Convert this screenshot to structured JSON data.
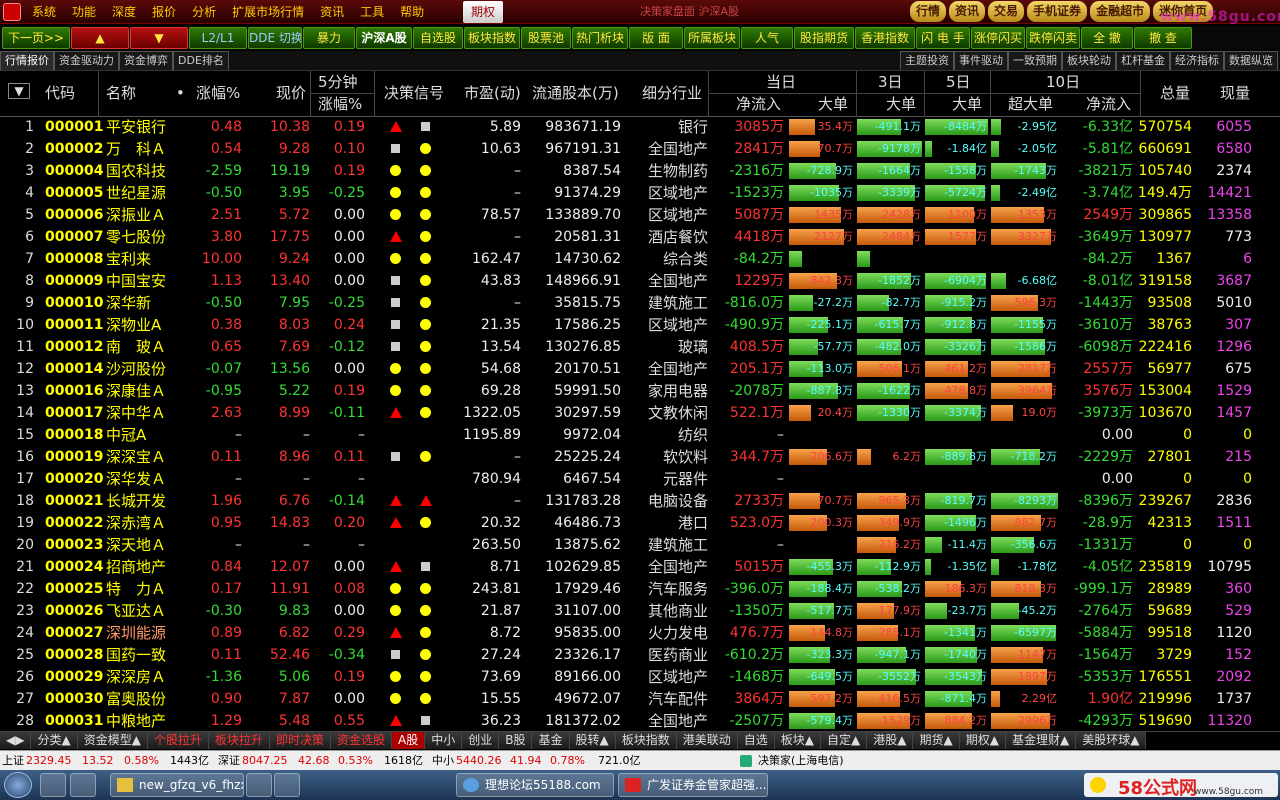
{
  "menu": [
    "系统",
    "功能",
    "深度",
    "报价",
    "分析",
    "扩展市场行情",
    "资讯",
    "工具",
    "帮助"
  ],
  "menu_active": "期权",
  "menu_marquee": "决策家盘面 沪深A股",
  "topright": [
    "行情",
    "资讯",
    "交易",
    "手机证券",
    "金融超市",
    "迷你首页"
  ],
  "watermark": "www.58gu.com",
  "toolbar": [
    "下一页>>",
    "▲",
    "▼",
    "L2/L1",
    "DDE 切换",
    "暴力",
    "沪深A股",
    "自选股",
    "板块指数",
    "股票池",
    "热门析块",
    "版 面",
    "所属板块",
    "人气",
    "股指期货",
    "香港指数",
    "闪 电 手",
    "涨停闪买",
    "跌停闪卖",
    "全 撤",
    "撤 查"
  ],
  "subtabs_left": [
    "行情报价",
    "资金驱动力",
    "资金博弈",
    "DDE排名"
  ],
  "subtabs_right": [
    "主题投资",
    "事件驱动",
    "一致预期",
    "板块轮动",
    "杠杆基金",
    "经济指标",
    "数据纵览"
  ],
  "headers": {
    "sort": "▼",
    "code": "代码",
    "name": "名称",
    "dot": "•",
    "change": "涨幅%",
    "price": "现价",
    "m5a": "5分钟",
    "m5b": "涨幅%",
    "signal": "决策信号",
    "pe": "市盈(动)",
    "float": "流通股本(万)",
    "industry": "细分行业",
    "today": "当日",
    "net": "净流入",
    "big": "大单",
    "d3": "3日",
    "d5": "5日",
    "d10": "10日",
    "superbig": "超大单",
    "net10": "净流入",
    "vol": "总量",
    "cur": "现量"
  },
  "rows": [
    {
      "i": "1",
      "code": "000001",
      "name": "平安银行",
      "chg": "0.48",
      "price": "10.38",
      "m5": "0.19",
      "sig": [
        "t",
        "s"
      ],
      "pe": "5.89",
      "float": "983671.19",
      "ind": "银行",
      "net": "3085万",
      "b1": [
        35.4,
        "35.4万"
      ],
      "b3": [
        -491.1,
        "-491.1万"
      ],
      "b5": [
        -8484,
        "-8484万"
      ],
      "b10": [
        -2.95,
        "-2.95亿"
      ],
      "net10": "-6.33亿",
      "vol": "570754",
      "cur": "6055"
    },
    {
      "i": "2",
      "code": "000002",
      "name": "万　科Ａ",
      "chg": "0.54",
      "price": "9.28",
      "m5": "0.10",
      "sig": [
        "s",
        "d"
      ],
      "pe": "10.63",
      "float": "967191.31",
      "ind": "全国地产",
      "net": "2841万",
      "b1": [
        70.7,
        "70.7万"
      ],
      "b3": [
        -9178,
        "-9178万"
      ],
      "b5": [
        -1.84,
        "-1.84亿"
      ],
      "b10": [
        -2.05,
        "-2.05亿"
      ],
      "net10": "-5.81亿",
      "vol": "660691",
      "cur": "6580"
    },
    {
      "i": "3",
      "code": "000004",
      "name": "国农科技",
      "chg": "-2.59",
      "price": "19.19",
      "m5": "0.19",
      "sig": [
        "d",
        "d"
      ],
      "pe": "–",
      "float": "8387.54",
      "ind": "生物制药",
      "net": "-2316万",
      "b1": [
        -728.9,
        "-728.9万"
      ],
      "b3": [
        -1664,
        "-1664万"
      ],
      "b5": [
        -1558,
        "-1558万"
      ],
      "b10": [
        -1743,
        "-1743万"
      ],
      "net10": "-3821万",
      "vol": "105740",
      "cur": "2374"
    },
    {
      "i": "4",
      "code": "000005",
      "name": "世纪星源",
      "chg": "-0.50",
      "price": "3.95",
      "m5": "-0.25",
      "sig": [
        "d",
        "d"
      ],
      "pe": "–",
      "float": "91374.29",
      "ind": "区域地产",
      "net": "-1523万",
      "b1": [
        -1035,
        "-1035万"
      ],
      "b3": [
        -3339,
        "-3339万"
      ],
      "b5": [
        -5724,
        "-5724万"
      ],
      "b10": [
        -2.49,
        "-2.49亿"
      ],
      "net10": "-3.74亿",
      "vol": "149.4万",
      "cur": "14421"
    },
    {
      "i": "5",
      "code": "000006",
      "name": "深振业Ａ",
      "chg": "2.51",
      "price": "5.72",
      "m5": "0.00",
      "sig": [
        "d",
        "d"
      ],
      "pe": "78.57",
      "float": "133889.70",
      "ind": "区域地产",
      "net": "5087万",
      "b1": [
        1435,
        "1435万"
      ],
      "b3": [
        2428,
        "2428万"
      ],
      "b5": [
        1100,
        "1100万"
      ],
      "b10": [
        1353,
        "1353万"
      ],
      "net10": "2549万",
      "vol": "309865",
      "cur": "13358"
    },
    {
      "i": "6",
      "code": "000007",
      "name": "零七股份",
      "chg": "3.80",
      "price": "17.75",
      "m5": "0.00",
      "sig": [
        "t",
        "d"
      ],
      "pe": "–",
      "float": "20581.31",
      "ind": "酒店餐饮",
      "net": "4418万",
      "b1": [
        2127,
        "2127万"
      ],
      "b3": [
        2484,
        "2484万"
      ],
      "b5": [
        1577,
        "1577万"
      ],
      "b10": [
        3327,
        "3327万"
      ],
      "net10": "-3649万",
      "vol": "130977",
      "cur": "773"
    },
    {
      "i": "7",
      "code": "000008",
      "name": "宝利来",
      "chg": "10.00",
      "price": "9.24",
      "m5": "0.00",
      "sig": [
        "d",
        "d"
      ],
      "pe": "162.47",
      "float": "14730.62",
      "ind": "综合类",
      "net": "-84.2万",
      "b1": [
        -5,
        ""
      ],
      "b3": [
        -5,
        ""
      ],
      "b5": [
        0,
        ""
      ],
      "b10": [
        0,
        ""
      ],
      "net10": "-84.2万",
      "vol": "1367",
      "cur": "6"
    },
    {
      "i": "8",
      "code": "000009",
      "name": "中国宝安",
      "chg": "1.13",
      "price": "13.40",
      "m5": "0.00",
      "sig": [
        "s",
        "d"
      ],
      "pe": "43.83",
      "float": "148966.91",
      "ind": "全国地产",
      "net": "1229万",
      "b1": [
        842.3,
        "842.3万"
      ],
      "b3": [
        -1852,
        "-1852万"
      ],
      "b5": [
        -6904,
        "-6904万"
      ],
      "b10": [
        -6.68,
        "-6.68亿"
      ],
      "net10": "-8.01亿",
      "vol": "319158",
      "cur": "3687"
    },
    {
      "i": "9",
      "code": "000010",
      "name": "深华新",
      "chg": "-0.50",
      "price": "7.95",
      "m5": "-0.25",
      "sig": [
        "s",
        "d"
      ],
      "pe": "–",
      "float": "35815.75",
      "ind": "建筑施工",
      "net": "-816.0万",
      "b1": [
        -27.2,
        "-27.2万"
      ],
      "b3": [
        -82.7,
        "-82.7万"
      ],
      "b5": [
        -915.2,
        "-915.2万"
      ],
      "b10": [
        596.3,
        "596.3万"
      ],
      "net10": "-1443万",
      "vol": "93508",
      "cur": "5010"
    },
    {
      "i": "10",
      "code": "000011",
      "name": "深物业A",
      "chg": "0.38",
      "price": "8.03",
      "m5": "0.24",
      "sig": [
        "s",
        "d"
      ],
      "pe": "21.35",
      "float": "17586.25",
      "ind": "区域地产",
      "net": "-490.9万",
      "b1": [
        -225.1,
        "-225.1万"
      ],
      "b3": [
        -615.7,
        "-615.7万"
      ],
      "b5": [
        -912.8,
        "-912.8万"
      ],
      "b10": [
        -1155,
        "-1155万"
      ],
      "net10": "-3610万",
      "vol": "38763",
      "cur": "307"
    },
    {
      "i": "11",
      "code": "000012",
      "name": "南　玻Ａ",
      "chg": "0.65",
      "price": "7.69",
      "m5": "-0.12",
      "sig": [
        "s",
        "d"
      ],
      "pe": "13.54",
      "float": "130276.85",
      "ind": "玻璃",
      "net": "408.5万",
      "b1": [
        -57.7,
        "-57.7万"
      ],
      "b3": [
        -482,
        "-482.0万"
      ],
      "b5": [
        -3326,
        "-3326万"
      ],
      "b10": [
        -1586,
        "-1586万"
      ],
      "net10": "-6098万",
      "vol": "222416",
      "cur": "1296"
    },
    {
      "i": "12",
      "code": "000014",
      "name": "沙河股份",
      "chg": "-0.07",
      "price": "13.56",
      "m5": "0.00",
      "sig": [
        "d",
        "d"
      ],
      "pe": "54.68",
      "float": "20170.51",
      "ind": "全国地产",
      "net": "205.1万",
      "b1": [
        -113,
        "-113.0万"
      ],
      "b3": [
        506.1,
        "506.1万"
      ],
      "b5": [
        461.2,
        "461.2万"
      ],
      "b10": [
        2817,
        "2817万"
      ],
      "net10": "2557万",
      "vol": "56977",
      "cur": "675"
    },
    {
      "i": "13",
      "code": "000016",
      "name": "深康佳Ａ",
      "chg": "-0.95",
      "price": "5.22",
      "m5": "0.19",
      "sig": [
        "d",
        "d"
      ],
      "pe": "69.28",
      "float": "59991.50",
      "ind": "家用电器",
      "net": "-2078万",
      "b1": [
        -887.8,
        "-887.8万"
      ],
      "b3": [
        -1622,
        "-1622万"
      ],
      "b5": [
        478.8,
        "478.8万"
      ],
      "b10": [
        3964,
        "3964万"
      ],
      "net10": "3576万",
      "vol": "153004",
      "cur": "1529"
    },
    {
      "i": "14",
      "code": "000017",
      "name": "深中华Ａ",
      "chg": "2.63",
      "price": "8.99",
      "m5": "-0.11",
      "sig": [
        "t",
        "d"
      ],
      "pe": "1322.05",
      "float": "30297.59",
      "ind": "文教休闲",
      "net": "522.1万",
      "b1": [
        20.4,
        "20.4万"
      ],
      "b3": [
        -1330,
        "-1330万"
      ],
      "b5": [
        -3374,
        "-3374万"
      ],
      "b10": [
        19,
        "19.0万"
      ],
      "net10": "-3973万",
      "vol": "103670",
      "cur": "1457"
    },
    {
      "i": "15",
      "code": "000018",
      "name": "中冠A",
      "chg": "–",
      "price": "–",
      "m5": "–",
      "sig": [],
      "pe": "1195.89",
      "float": "9972.04",
      "ind": "纺织",
      "net": "–",
      "b1": [
        0,
        ""
      ],
      "b3": [
        0,
        ""
      ],
      "b5": [
        0,
        ""
      ],
      "b10": [
        0,
        ""
      ],
      "net10": "0.00",
      "vol": "0",
      "cur": "0"
    },
    {
      "i": "16",
      "code": "000019",
      "name": "深深宝Ａ",
      "chg": "0.11",
      "price": "8.96",
      "m5": "0.11",
      "sig": [
        "s",
        "d"
      ],
      "pe": "–",
      "float": "25225.24",
      "ind": "软饮料",
      "net": "344.7万",
      "b1": [
        206.6,
        "206.6万"
      ],
      "b3": [
        6.2,
        "6.2万"
      ],
      "b5": [
        -889.8,
        "-889.8万"
      ],
      "b10": [
        -718.2,
        "-718.2万"
      ],
      "net10": "-2229万",
      "vol": "27801",
      "cur": "215"
    },
    {
      "i": "17",
      "code": "000020",
      "name": "深华发Ａ",
      "chg": "–",
      "price": "–",
      "m5": "–",
      "sig": [],
      "pe": "780.94",
      "float": "6467.54",
      "ind": "元器件",
      "net": "–",
      "b1": [
        0,
        ""
      ],
      "b3": [
        0,
        ""
      ],
      "b5": [
        0,
        ""
      ],
      "b10": [
        0,
        ""
      ],
      "net10": "0.00",
      "vol": "0",
      "cur": "0"
    },
    {
      "i": "18",
      "code": "000021",
      "name": "长城开发",
      "chg": "1.96",
      "price": "6.76",
      "m5": "-0.14",
      "sig": [
        "t",
        "t"
      ],
      "pe": "–",
      "float": "131783.28",
      "ind": "电脑设备",
      "net": "2733万",
      "b1": [
        70.7,
        "70.7万"
      ],
      "b3": [
        965.3,
        "965.3万"
      ],
      "b5": [
        -819.7,
        "-819.7万"
      ],
      "b10": [
        -8293,
        "-8293万"
      ],
      "net10": "-8396万",
      "vol": "239267",
      "cur": "2836"
    },
    {
      "i": "19",
      "code": "000022",
      "name": "深赤湾Ａ",
      "chg": "0.95",
      "price": "14.83",
      "m5": "0.20",
      "sig": [
        "t",
        "d"
      ],
      "pe": "20.32",
      "float": "46486.73",
      "ind": "港口",
      "net": "523.0万",
      "b1": [
        200.3,
        "200.3万"
      ],
      "b3": [
        349.9,
        "349.9万"
      ],
      "b5": [
        -1496,
        "-1496万"
      ],
      "b10": [
        882.7,
        "882.7万"
      ],
      "net10": "-28.9万",
      "vol": "42313",
      "cur": "1511"
    },
    {
      "i": "20",
      "code": "000023",
      "name": "深天地Ａ",
      "chg": "–",
      "price": "–",
      "m5": "–",
      "sig": [],
      "pe": "263.50",
      "float": "13875.62",
      "ind": "建筑施工",
      "net": "–",
      "b1": [
        0,
        ""
      ],
      "b3": [
        216.2,
        "216.2万"
      ],
      "b5": [
        -11.4,
        "-11.4万"
      ],
      "b10": [
        -356.6,
        "-356.6万"
      ],
      "net10": "-1331万",
      "vol": "0",
      "cur": "0"
    },
    {
      "i": "21",
      "code": "000024",
      "name": "招商地产",
      "chg": "0.84",
      "price": "12.07",
      "m5": "0.00",
      "sig": [
        "t",
        "s"
      ],
      "pe": "8.71",
      "float": "102629.85",
      "ind": "全国地产",
      "net": "5015万",
      "b1": [
        -455.3,
        "-455.3万"
      ],
      "b3": [
        -112.9,
        "-112.9万"
      ],
      "b5": [
        -1.35,
        "-1.35亿"
      ],
      "b10": [
        -1.78,
        "-1.78亿"
      ],
      "net10": "-4.05亿",
      "vol": "235819",
      "cur": "10795"
    },
    {
      "i": "22",
      "code": "000025",
      "name": "特　力Ａ",
      "chg": "0.17",
      "price": "11.91",
      "m5": "0.08",
      "sig": [
        "d",
        "d"
      ],
      "pe": "243.81",
      "float": "17929.46",
      "ind": "汽车服务",
      "net": "-396.0万",
      "b1": [
        -188.4,
        "-188.4万"
      ],
      "b3": [
        -538.2,
        "-538.2万"
      ],
      "b5": [
        186.3,
        "186.3万"
      ],
      "b10": [
        818.3,
        "818.3万"
      ],
      "net10": "-999.1万",
      "vol": "28989",
      "cur": "360"
    },
    {
      "i": "23",
      "code": "000026",
      "name": "飞亚达Ａ",
      "chg": "-0.30",
      "price": "9.83",
      "m5": "0.00",
      "sig": [
        "d",
        "d"
      ],
      "pe": "21.87",
      "float": "31107.00",
      "ind": "其他商业",
      "net": "-1350万",
      "b1": [
        -517.7,
        "-517.7万"
      ],
      "b3": [
        177.9,
        "177.9万"
      ],
      "b5": [
        -23.7,
        "-23.7万"
      ],
      "b10": [
        -45.2,
        "-45.2万"
      ],
      "net10": "-2764万",
      "vol": "59689",
      "cur": "529"
    },
    {
      "i": "24",
      "code": "000027",
      "name": "深圳能源",
      "chg": "0.89",
      "price": "6.82",
      "m5": "0.29",
      "sig": [
        "t",
        "d"
      ],
      "pe": "8.72",
      "float": "95835.00",
      "ind": "火力发电",
      "net": "476.7万",
      "b1": [
        144.8,
        "144.8万"
      ],
      "b3": [
        285.1,
        "285.1万"
      ],
      "b5": [
        -1341,
        "-1341万"
      ],
      "b10": [
        -6597,
        "-6597万"
      ],
      "net10": "-5884万",
      "vol": "99518",
      "cur": "1120"
    },
    {
      "i": "25",
      "code": "000028",
      "name": "国药一致",
      "chg": "0.11",
      "price": "52.46",
      "m5": "-0.34",
      "sig": [
        "s",
        "d"
      ],
      "pe": "27.24",
      "float": "23326.17",
      "ind": "医药商业",
      "net": "-610.2万",
      "b1": [
        -323.3,
        "-323.3万"
      ],
      "b3": [
        -947.1,
        "-947.1万"
      ],
      "b5": [
        -1740,
        "-1740万"
      ],
      "b10": [
        1147,
        "1147万"
      ],
      "net10": "-1564万",
      "vol": "3729",
      "cur": "152"
    },
    {
      "i": "26",
      "code": "000029",
      "name": "深深房Ａ",
      "chg": "-1.36",
      "price": "5.06",
      "m5": "0.19",
      "sig": [
        "d",
        "d"
      ],
      "pe": "73.69",
      "float": "89166.00",
      "ind": "区域地产",
      "net": "-1468万",
      "b1": [
        -649.5,
        "-649.5万"
      ],
      "b3": [
        -3552,
        "-3552万"
      ],
      "b5": [
        -3543,
        "-3543万"
      ],
      "b10": [
        1897,
        "1897万"
      ],
      "net10": "-5353万",
      "vol": "176551",
      "cur": "2092"
    },
    {
      "i": "27",
      "code": "000030",
      "name": "富奥股份",
      "chg": "0.90",
      "price": "7.87",
      "m5": "0.00",
      "sig": [
        "d",
        "d"
      ],
      "pe": "15.55",
      "float": "49672.07",
      "ind": "汽车配件",
      "net": "3864万",
      "b1": [
        597.2,
        "597.2万"
      ],
      "b3": [
        416.5,
        "416.5万"
      ],
      "b5": [
        -871.4,
        "-871.4万"
      ],
      "b10": [
        2.29,
        "2.29亿"
      ],
      "net10": "1.90亿",
      "vol": "219996",
      "cur": "1737"
    },
    {
      "i": "28",
      "code": "000031",
      "name": "中粮地产",
      "chg": "1.29",
      "price": "5.48",
      "m5": "0.55",
      "sig": [
        "t",
        "s"
      ],
      "pe": "36.23",
      "float": "181372.02",
      "ind": "全国地产",
      "net": "-2507万",
      "b1": [
        -579.4,
        "-579.4万"
      ],
      "b3": [
        1529,
        "1529万"
      ],
      "b5": [
        884.2,
        "884.2万"
      ],
      "b10": [
        2996,
        "2996万"
      ],
      "net10": "-4293万",
      "vol": "519690",
      "cur": "11320"
    }
  ],
  "bottom_tabs": [
    {
      "label": "◀▶",
      "s": ""
    },
    {
      "label": "分类▲",
      "s": ""
    },
    {
      "label": "资金模型▲",
      "s": ""
    },
    {
      "label": "个股拉升",
      "s": "red"
    },
    {
      "label": "板块拉升",
      "s": "red"
    },
    {
      "label": "即时决策",
      "s": "red"
    },
    {
      "label": "资金选股",
      "s": "red"
    },
    {
      "label": "A股",
      "s": "active"
    },
    {
      "label": "中小",
      "s": ""
    },
    {
      "label": "创业",
      "s": ""
    },
    {
      "label": "B股",
      "s": ""
    },
    {
      "label": "基金",
      "s": ""
    },
    {
      "label": "股转▲",
      "s": ""
    },
    {
      "label": "板块指数",
      "s": ""
    },
    {
      "label": "港美联动",
      "s": ""
    },
    {
      "label": "自选",
      "s": ""
    },
    {
      "label": "板块▲",
      "s": ""
    },
    {
      "label": "自定▲",
      "s": ""
    },
    {
      "label": "港股▲",
      "s": ""
    },
    {
      "label": "期货▲",
      "s": ""
    },
    {
      "label": "期权▲",
      "s": ""
    },
    {
      "label": "基金理财▲",
      "s": ""
    },
    {
      "label": "美股环球▲",
      "s": ""
    }
  ],
  "status": {
    "sh_label": "上证",
    "sh_idx": "2329.45",
    "sh_chg": "13.52",
    "sh_pct": "0.58%",
    "sh_amt": "1443亿",
    "sz_label": "深证",
    "sz_idx": "8047.25",
    "sz_chg": "42.68",
    "sz_pct": "0.53%",
    "sz_amt": "1618亿",
    "zx_label": "中小",
    "zx_idx": "5440.26",
    "zx_chg": "41.94",
    "zx_pct": "0.78%",
    "zx_amt": "721.0亿",
    "server": "决策家(上海电信)"
  },
  "taskbar": [
    {
      "label": "new_gfzq_v6_fhzx"
    },
    {
      "label": "理想论坛55188.com"
    },
    {
      "label": "广发证券金管家超强..."
    }
  ],
  "tray": {
    "brand": "58公式网",
    "url": "www.58gu.com"
  },
  "colors": {
    "up": "#ff3333",
    "down": "#33dd33",
    "code": "#ffff00",
    "accent": "#ffcc00"
  }
}
